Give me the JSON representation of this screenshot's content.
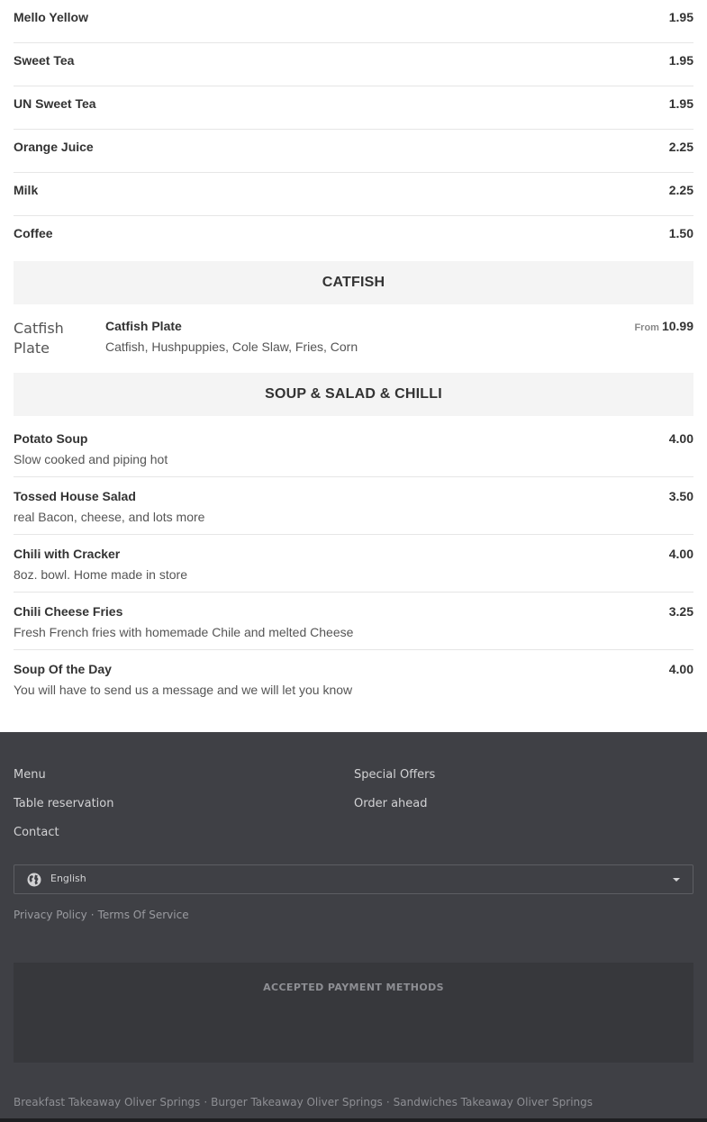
{
  "drinks": [
    {
      "name": "Mello Yellow",
      "price": "1.95"
    },
    {
      "name": "Sweet Tea",
      "price": "1.95"
    },
    {
      "name": "UN Sweet Tea",
      "price": "1.95"
    },
    {
      "name": "Orange Juice",
      "price": "2.25"
    },
    {
      "name": "Milk",
      "price": "2.25"
    },
    {
      "name": "Coffee",
      "price": "1.50"
    }
  ],
  "catfish_section": {
    "title": "CATFISH",
    "item": {
      "image_alt": "Catfish Plate",
      "name": "Catfish Plate",
      "description": "Catfish, Hushpuppies, Cole Slaw, Fries, Corn",
      "price_prefix": "From",
      "price": "10.99"
    }
  },
  "soup_section": {
    "title": "SOUP & SALAD & CHILLI",
    "items": [
      {
        "name": "Potato Soup",
        "description": "Slow cooked and piping hot",
        "price": "4.00"
      },
      {
        "name": "Tossed House Salad",
        "description": "real Bacon, cheese, and lots more",
        "price": "3.50"
      },
      {
        "name": "Chili with Cracker",
        "description": "8oz. bowl. Home made in store",
        "price": "4.00"
      },
      {
        "name": "Chili Cheese Fries",
        "description": "Fresh French fries with homemade Chile and melted Cheese",
        "price": "3.25"
      },
      {
        "name": "Soup Of the Day",
        "description": "You will have to send us a message and we will let you know",
        "price": "4.00"
      }
    ]
  },
  "footer": {
    "nav": {
      "menu": "Menu",
      "table_reservation": "Table reservation",
      "contact": "Contact",
      "special_offers": "Special Offers",
      "order_ahead": "Order ahead"
    },
    "language": {
      "selected": "English",
      "icon": "globe-icon"
    },
    "legal": {
      "privacy": "Privacy Policy",
      "separator": "·",
      "terms": "Terms Of Service"
    },
    "payment_title": "ACCEPTED PAYMENT METHODS",
    "bottom_links": [
      "Breakfast Takeaway Oliver Springs",
      "Burger Takeaway Oliver Springs",
      "Sandwiches Takeaway Oliver Springs"
    ]
  },
  "colors": {
    "footer_bg": "#3f4045",
    "section_header_bg": "#f4f4f4",
    "payment_box_bg": "#37383c"
  }
}
